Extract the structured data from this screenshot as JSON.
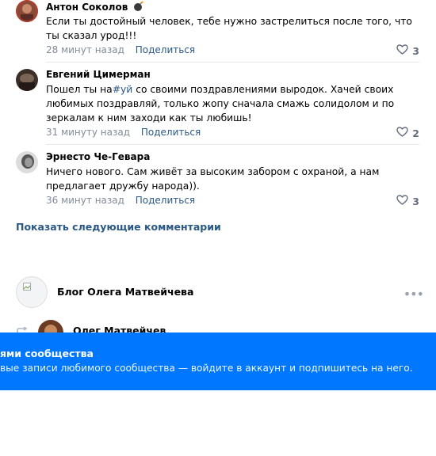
{
  "comments": [
    {
      "author": "Антон Соколов",
      "author_badge_icon": "bomb-icon",
      "text": "Если ты достойный человек, тебе нужно застрелиться после того, что ты сказал урод!!!",
      "time": "28 минут назад",
      "share_label": "Поделиться",
      "likes": "3"
    },
    {
      "author": "Евгений Цимерман",
      "text_before": "Пошел ты на",
      "hashtag": "#уй",
      "text_after": " со своими поздравлениями выродок. Хачей своих любимых поздравляй, только жопу сначала смажь солидолом и по зеркалам к ним заходи как ты любишь!",
      "time": "31 минуту назад",
      "share_label": "Поделиться",
      "likes": "2"
    },
    {
      "author": "Эрнесто Че-Гевара",
      "text": "Ничего нового. Сам живёт за высоким забором с охраной, а нам предлагает дружбу народа)).",
      "time": "36 минут назад",
      "share_label": "Поделиться",
      "likes": "3"
    }
  ],
  "more_comments_label": "Показать следующие комментарии",
  "post": {
    "community_name": "Блог Олега Матвейчева",
    "repost_author": "Олег Матвейчев",
    "menu_icon": "more-horizontal-icon"
  },
  "banner": {
    "title": "ями сообщества",
    "text": "вые записи любимого сообщества — войдите в аккаунт и подпишитесь на него."
  },
  "colors": {
    "link": "#2a5885",
    "meta": "#818c99",
    "banner": "#0077ff"
  }
}
